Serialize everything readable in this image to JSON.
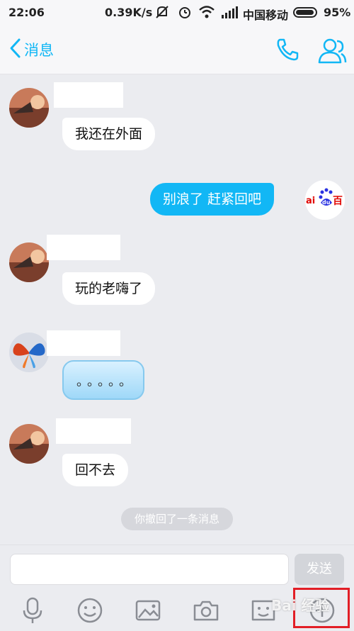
{
  "status_bar": {
    "time": "22:06",
    "net_speed": "0.39K/s",
    "carrier": "中国移动",
    "battery": "95%"
  },
  "header": {
    "back_label": "消息",
    "phone_icon": "phone-icon",
    "profile_icon": "profile-icon"
  },
  "messages": [
    {
      "side": "left",
      "text": "我还在外面"
    },
    {
      "side": "right",
      "text": "别浪了  赶紧回吧",
      "avatar_logo": "Bai du 百"
    },
    {
      "side": "left",
      "text": "玩的老嗨了"
    },
    {
      "side": "left",
      "sticker": "。。。。。"
    },
    {
      "side": "left",
      "text": "回不去"
    }
  ],
  "system_note": "你撤回了一条消息",
  "composer": {
    "placeholder": "",
    "send_label": "发送"
  },
  "toolbar": [
    "mic-icon",
    "emoji-icon",
    "image-icon",
    "camera-icon",
    "sticker-icon",
    "plus-icon"
  ],
  "watermark": "Bai 经验",
  "colors": {
    "accent": "#12b7f5",
    "highlight": "#e21e26",
    "background": "#ebecf0"
  }
}
